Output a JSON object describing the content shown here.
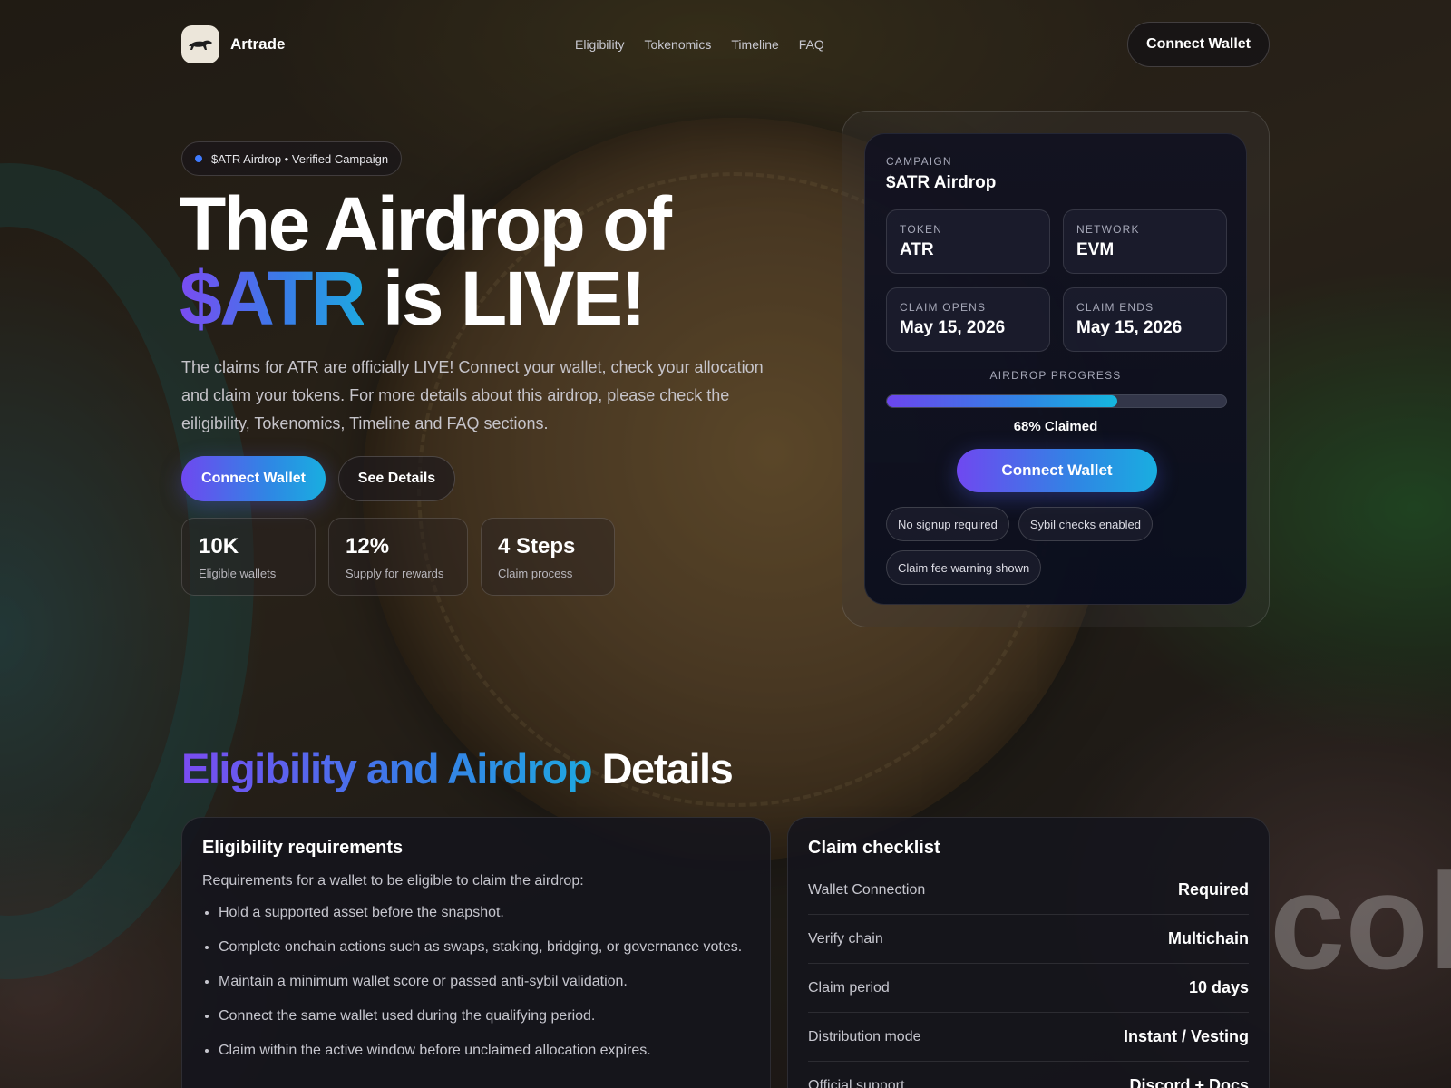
{
  "header": {
    "brand": "Artrade",
    "nav": [
      "Eligibility",
      "Tokenomics",
      "Timeline",
      "FAQ"
    ],
    "connect_label": "Connect Wallet"
  },
  "hero": {
    "pill_text": "$ATR Airdrop • Verified Campaign",
    "title_line1": "The Airdrop of",
    "title_highlight": "$ATR",
    "title_rest": "is LIVE!",
    "description": "The claims for ATR are officially LIVE! Connect your wallet, check your allocation and claim your tokens. For more details about this airdrop, please check the eiligibility, Tokenomics, Timeline and FAQ sections.",
    "primary_cta": "Connect Wallet",
    "secondary_cta": "See Details",
    "stats": [
      {
        "value": "10K",
        "label": "Eligible wallets"
      },
      {
        "value": "12%",
        "label": "Supply for rewards"
      },
      {
        "value": "4 Steps",
        "label": "Claim process"
      }
    ]
  },
  "campaign": {
    "kicker": "CAMPAIGN",
    "title": "$ATR Airdrop",
    "token_label": "TOKEN",
    "token_value": "ATR",
    "network_label": "NETWORK",
    "network_value": "EVM",
    "opens_label": "CLAIM OPENS",
    "opens_value": "May 15, 2026",
    "ends_label": "CLAIM ENDS",
    "ends_value": "May 15, 2026",
    "progress_label": "AIRDROP PROGRESS",
    "progress_fraction": 0.68,
    "progress_text": "68% Claimed",
    "cta": "Connect Wallet",
    "chips": [
      "No signup required",
      "Sybil checks enabled",
      "Claim fee warning shown"
    ]
  },
  "details": {
    "title_highlight": "Eligibility and Airdrop",
    "title_rest": "Details",
    "requirements": {
      "title": "Eligibility requirements",
      "intro": "Requirements for a wallet to be eligible to claim the airdrop:",
      "items": [
        "Hold a supported asset before the snapshot.",
        "Complete onchain actions such as swaps, staking, bridging, or governance votes.",
        "Maintain a minimum wallet score or passed anti-sybil validation.",
        "Connect the same wallet used during the qualifying period.",
        "Claim within the active window before unclaimed allocation expires."
      ]
    },
    "checklist": {
      "title": "Claim checklist",
      "rows": [
        {
          "key": "Wallet Connection",
          "value": "Required"
        },
        {
          "key": "Verify chain",
          "value": "Multichain"
        },
        {
          "key": "Claim period",
          "value": "10 days"
        },
        {
          "key": "Distribution mode",
          "value": "Instant / Vesting"
        },
        {
          "key": "Official support",
          "value": "Discord + Docs"
        }
      ]
    }
  },
  "background_text": "col",
  "colors": {
    "accent_purple": "#6f48f0",
    "accent_blue": "#2f86e4",
    "accent_cyan": "#19aee0",
    "status_dot": "#3f7bff"
  }
}
